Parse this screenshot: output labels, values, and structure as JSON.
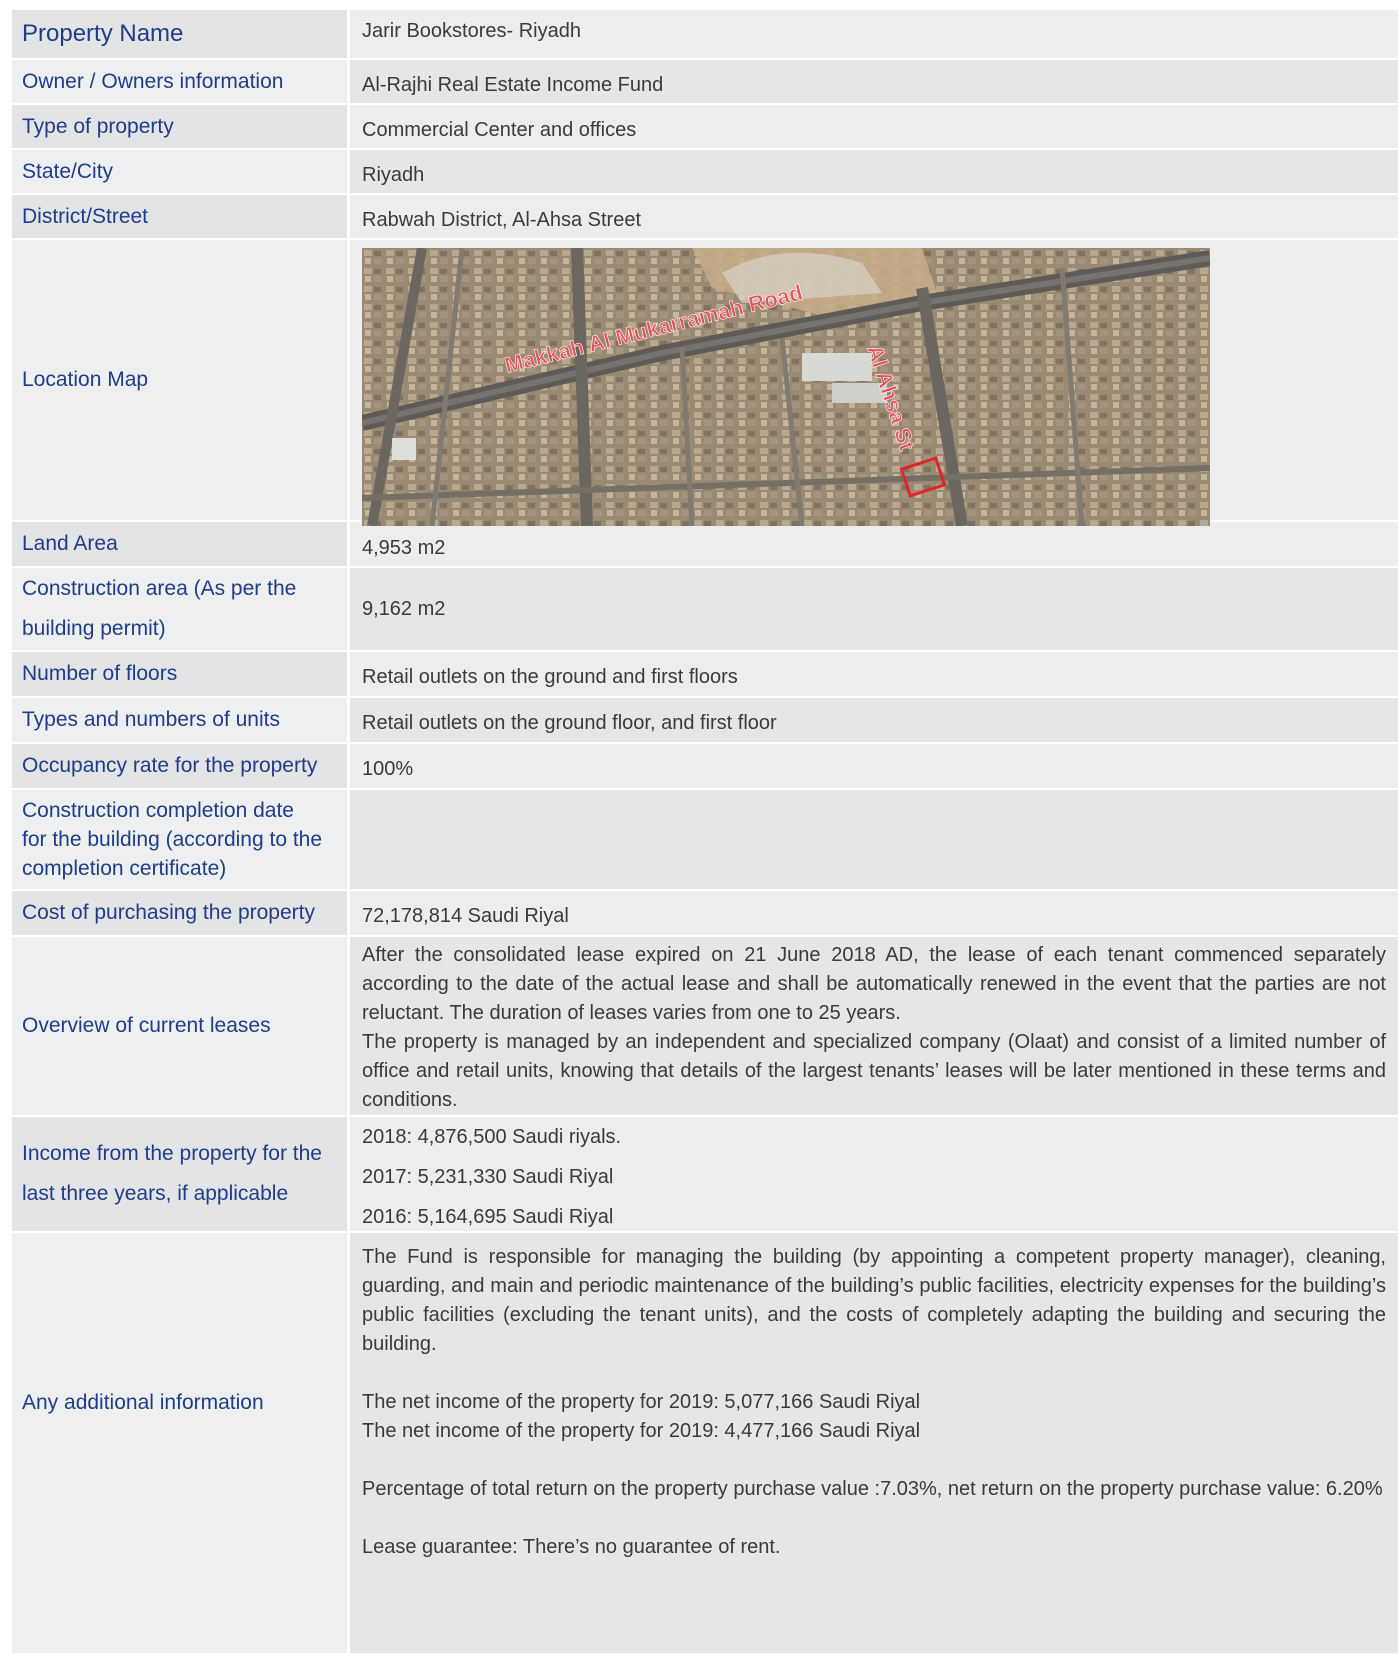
{
  "rows": [
    {
      "label": "Property Name",
      "value": "Jarir Bookstores- Riyadh"
    },
    {
      "label": "Owner / Owners information",
      "value": "Al-Rajhi Real Estate Income Fund"
    },
    {
      "label": "Type of property",
      "value": "Commercial Center and offices"
    },
    {
      "label": "State/City",
      "value": "Riyadh"
    },
    {
      "label": "District/Street",
      "value": "Rabwah District, Al-Ahsa Street"
    },
    {
      "label": "Location Map"
    },
    {
      "label": "Land Area",
      "value": "4,953 m2"
    },
    {
      "label_lines": [
        "Construction area (As per the",
        "building permit)"
      ],
      "value": "9,162 m2"
    },
    {
      "label": "Number of floors",
      "value": "Retail outlets on the ground and first floors"
    },
    {
      "label": "Types and numbers of units",
      "value": "Retail outlets on the ground floor, and first floor"
    },
    {
      "label": "Occupancy rate for the property",
      "value": "100%"
    },
    {
      "label_lines": [
        "Construction completion date",
        "for the building (according to the",
        "completion certificate)"
      ],
      "value": ""
    },
    {
      "label": "Cost of purchasing the property",
      "value": "72,178,814 Saudi Riyal"
    },
    {
      "label": "Overview of current leases",
      "paragraphs": [
        "After the consolidated lease expired on 21 June 2018 AD, the lease of each tenant commenced separately according to the date of the actual lease and shall be automatically renewed in the event that the parties are not reluctant. The duration of leases varies from one to 25 years.",
        "The property is managed by an independent and specialized company (Olaat) and consist of a limited number of office and retail units, knowing that details of the largest tenants’ leases will be later mentioned in these terms and conditions."
      ]
    },
    {
      "label_lines": [
        "Income from the property for the",
        "last three years, if applicable"
      ],
      "values": [
        "2018: 4,876,500 Saudi riyals.",
        "2017: 5,231,330 Saudi Riyal",
        "2016: 5,164,695 Saudi Riyal"
      ]
    },
    {
      "label": "Any additional information",
      "paragraphs": [
        "The Fund is responsible for managing the building (by appointing a competent property manager), cleaning, guarding, and main and periodic maintenance of the building’s public facilities, electricity expenses for the building’s public facilities (excluding the tenant units), and the costs of completely adapting the building and securing the building.",
        "The net income of the property for 2019: 5,077,166 Saudi Riyal",
        "The net income of the property for 2019: 4,477,166 Saudi Riyal",
        "Percentage of total return on the property purchase value :7.03%, net return on the property purchase value: 6.20%",
        "Lease guarantee: There’s no guarantee of rent."
      ]
    }
  ],
  "map": {
    "road_label": "Makkah Al Mukarramah Road",
    "street_label": "Al Ahsa St",
    "marker_color": "#e0262b",
    "label_color": "#e8505a"
  },
  "colors": {
    "label_text": "#1f3c88",
    "value_text": "#3a3a3a"
  }
}
